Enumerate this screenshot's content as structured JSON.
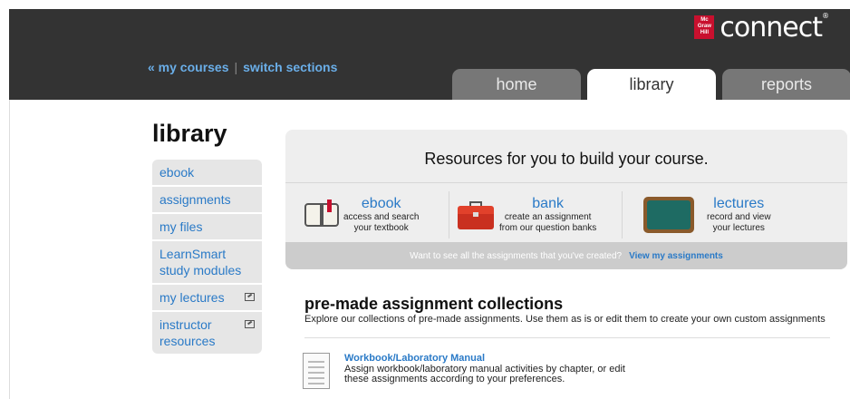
{
  "brand": {
    "logo_text": "Mc Graw Hill",
    "word": "connect"
  },
  "header": {
    "my_courses": "« my courses",
    "separator": "|",
    "switch_sections": "switch sections",
    "tabs": [
      {
        "label": "home",
        "active": false
      },
      {
        "label": "library",
        "active": true
      },
      {
        "label": "reports",
        "active": false
      }
    ]
  },
  "page": {
    "title": "library"
  },
  "sidebar": {
    "items": [
      {
        "label": "ebook"
      },
      {
        "label": "assignments"
      },
      {
        "label": "my files"
      },
      {
        "label": "LearnSmart study modules"
      },
      {
        "label": "my lectures",
        "icon": "external-link-icon"
      },
      {
        "label": "instructor resources",
        "icon": "external-link-icon"
      }
    ]
  },
  "resources": {
    "heading": "Resources for you to build your course.",
    "items": [
      {
        "title": "ebook",
        "desc1": "access and search",
        "desc2": "your textbook",
        "icon": "book-icon"
      },
      {
        "title": "bank",
        "desc1": "create an assignment",
        "desc2": "from our question banks",
        "icon": "toolbox-icon"
      },
      {
        "title": "lectures",
        "desc1": "record and view",
        "desc2": "your lectures",
        "icon": "chalkboard-icon"
      }
    ],
    "footer_text": "Want to see all the assignments that you've created?",
    "footer_link": "View my assignments"
  },
  "premade": {
    "heading": "pre-made assignment collections",
    "desc": "Explore our collections of pre-made assignments. Use them as is or edit them to create your own custom assignments",
    "items": [
      {
        "title": "Workbook/Laboratory Manual",
        "desc1": "Assign workbook/laboratory manual activities by chapter, or edit",
        "desc2": "these assignments according to your preferences.",
        "icon": "document-icon"
      }
    ]
  },
  "colors": {
    "header_bg": "#333333",
    "link_blue": "#2a7ac7",
    "tab_inactive": "#777777",
    "panel_bg": "#eeeeee"
  }
}
